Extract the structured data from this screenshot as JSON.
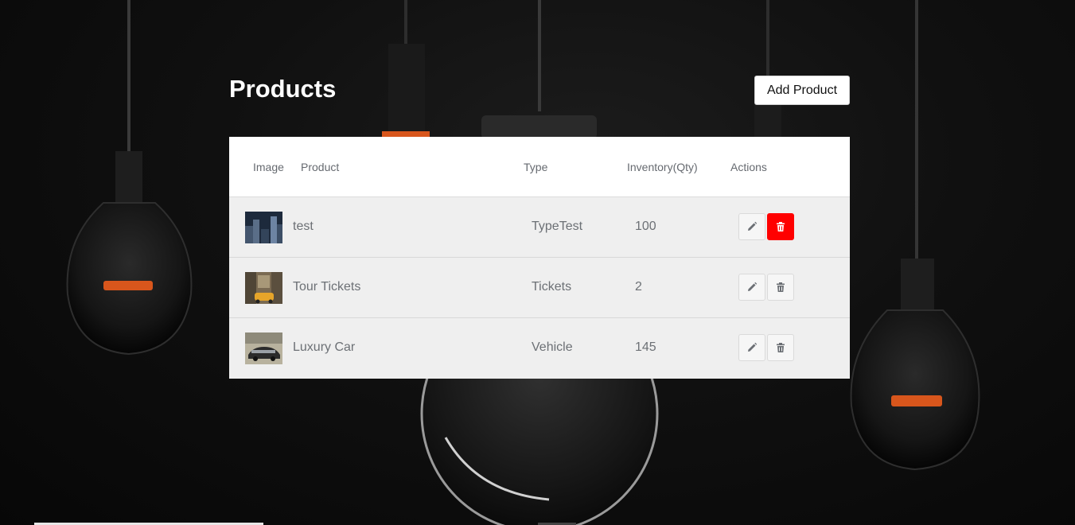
{
  "header": {
    "title": "Products",
    "add_button_label": "Add Product"
  },
  "table": {
    "columns": [
      "Image",
      "Product",
      "Type",
      "Inventory(Qty)",
      "Actions"
    ],
    "rows": [
      {
        "product": "test",
        "type": "TypeTest",
        "inventory": "100",
        "thumbnail": "city-night-image",
        "delete_highlighted": true
      },
      {
        "product": "Tour Tickets",
        "type": "Tickets",
        "inventory": "2",
        "thumbnail": "yellow-taxi-street-image",
        "delete_highlighted": false
      },
      {
        "product": "Luxury Car",
        "type": "Vehicle",
        "inventory": "145",
        "thumbnail": "luxury-car-image",
        "delete_highlighted": false
      }
    ]
  },
  "icons": {
    "edit": "pencil-icon",
    "delete": "trash-icon"
  },
  "colors": {
    "delete_active": "#ff0000",
    "row_background": "#efefef",
    "header_background": "#ffffff"
  }
}
